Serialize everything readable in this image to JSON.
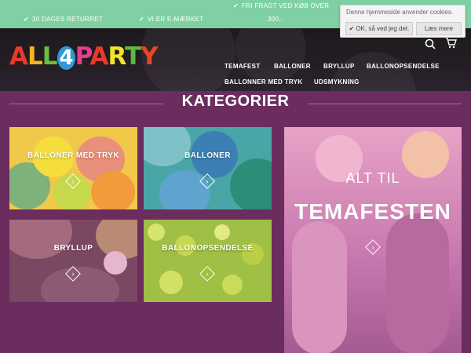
{
  "topbar": {
    "returns": "30 DAGES RETURRET",
    "emaerke": "VI ER E-MÆRKET",
    "free_shipping": "FRI FRAGT VED KØB OVER",
    "threshold": "300,-",
    "check_glyph": "✔"
  },
  "cookie": {
    "message": "Denne hjemmeside anvender cookies.",
    "ok_label": "OK, så ved jeg det.",
    "more_label": "Læs mere"
  },
  "header": {
    "logo": {
      "a": "A",
      "l1": "L",
      "l2": "L",
      "four": "4",
      "p": "P",
      "ar": "A",
      "r": "R",
      "t": "T",
      "y": "Y"
    },
    "search_icon": "search-icon",
    "cart_icon": "cart-icon"
  },
  "nav": {
    "items": [
      "TEMAFEST",
      "BALLONER",
      "BRYLLUP",
      "BALLONOPSENDELSE",
      "BALLONNER MED TRYK",
      "UDSMYKNING"
    ]
  },
  "main": {
    "heading": "KATEGORIER",
    "tiles": [
      {
        "label": "BALLONER MED TRYK"
      },
      {
        "label": "BALLONER"
      },
      {
        "label": "BRYLLUP"
      },
      {
        "label": "BALLONOPSENDELSE"
      }
    ],
    "promo": {
      "line1": "ALT TIL",
      "line2": "TEMAFESTEN"
    }
  },
  "colors": {
    "topbar": "#7fd1a3",
    "background": "#6b2c5e",
    "header": "#1d1a1e"
  }
}
